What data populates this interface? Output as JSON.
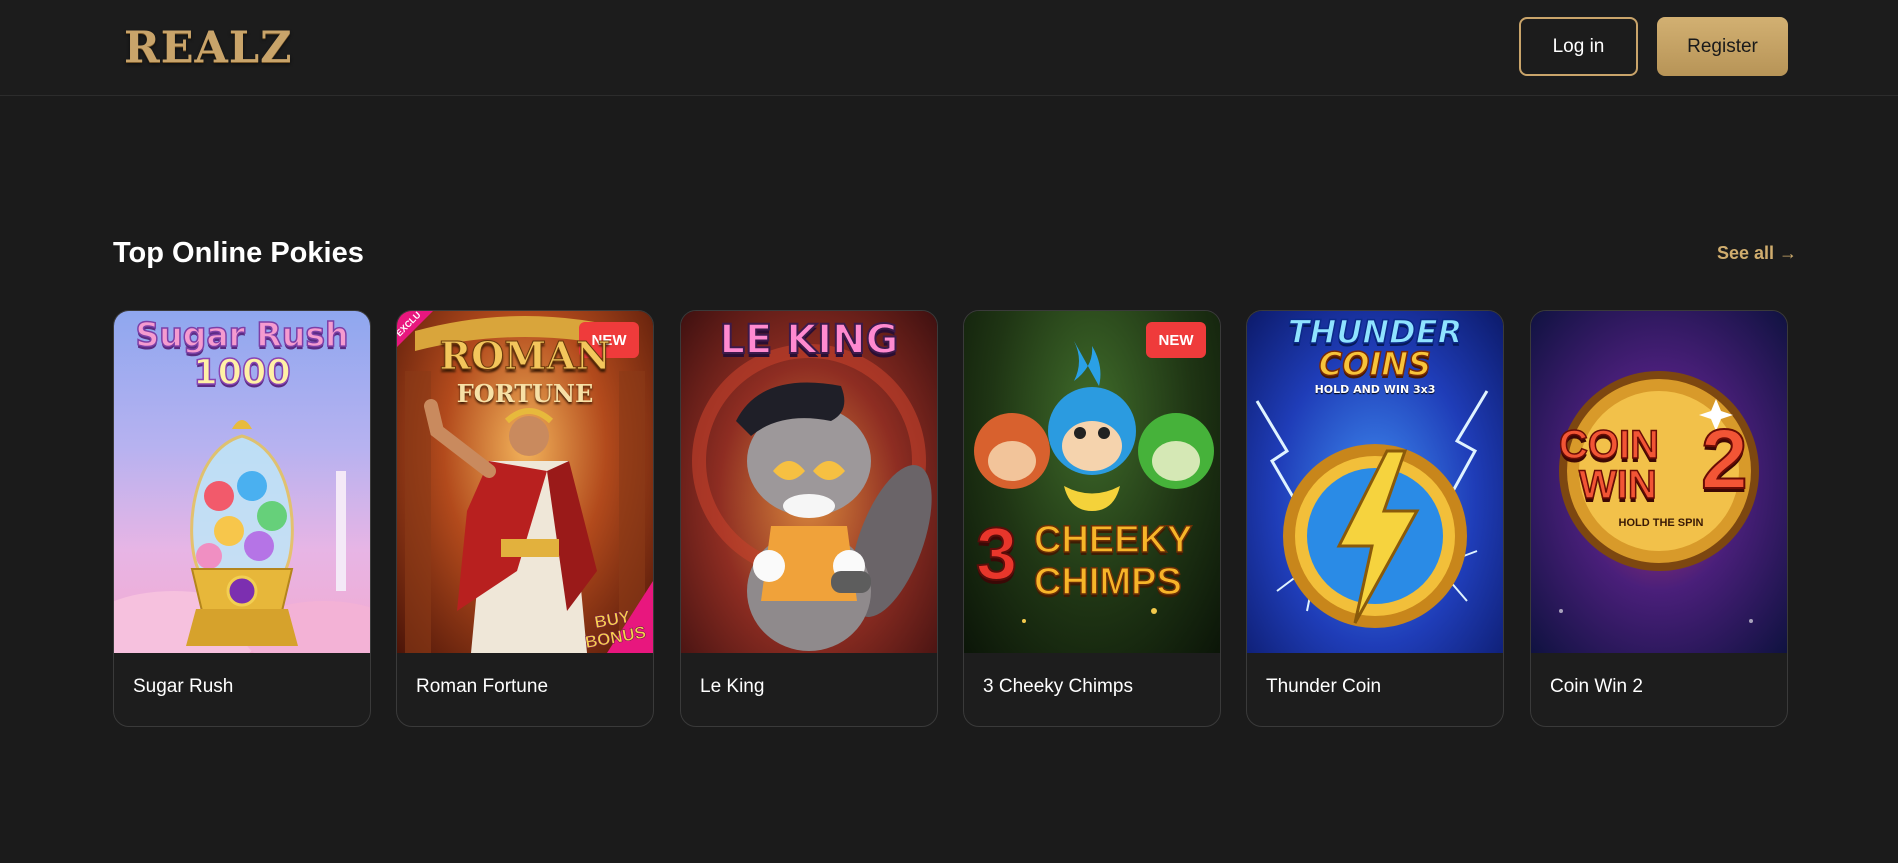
{
  "header": {
    "logo_text": "REALZ",
    "login_label": "Log in",
    "register_label": "Register"
  },
  "section": {
    "title": "Top Online Pokies",
    "see_all_label": "See all →"
  },
  "games": [
    {
      "name": "Sugar Rush",
      "art_title_1": "Sugar Rush",
      "art_title_2": "1000",
      "badge": ""
    },
    {
      "name": "Roman Fortune",
      "art_title_1": "ROMAN",
      "art_title_2": "FORTUNE",
      "badge": "NEW",
      "corner_ribbon": "EXCLU",
      "bottom_tag": "BUY BONUS"
    },
    {
      "name": "Le King",
      "art_title_1": "LE KING",
      "badge": ""
    },
    {
      "name": "3 Cheeky Chimps",
      "art_title_1": "3",
      "art_title_2": "CHEEKY",
      "art_title_3": "CHIMPS",
      "badge": "NEW"
    },
    {
      "name": "Thunder Coin",
      "art_title_1": "THUNDER",
      "art_title_2": "COINS",
      "art_title_3": "HOLD AND WIN 3x3",
      "badge": ""
    },
    {
      "name": "Coin Win 2",
      "art_title_1": "COIN",
      "art_title_2": "WIN",
      "art_title_3": "2",
      "art_title_4": "HOLD THE SPIN",
      "badge": ""
    }
  ],
  "colors": {
    "background": "#1b1b1b",
    "accent_gold": "#c9a46a",
    "badge_red": "#ef3b3b"
  }
}
